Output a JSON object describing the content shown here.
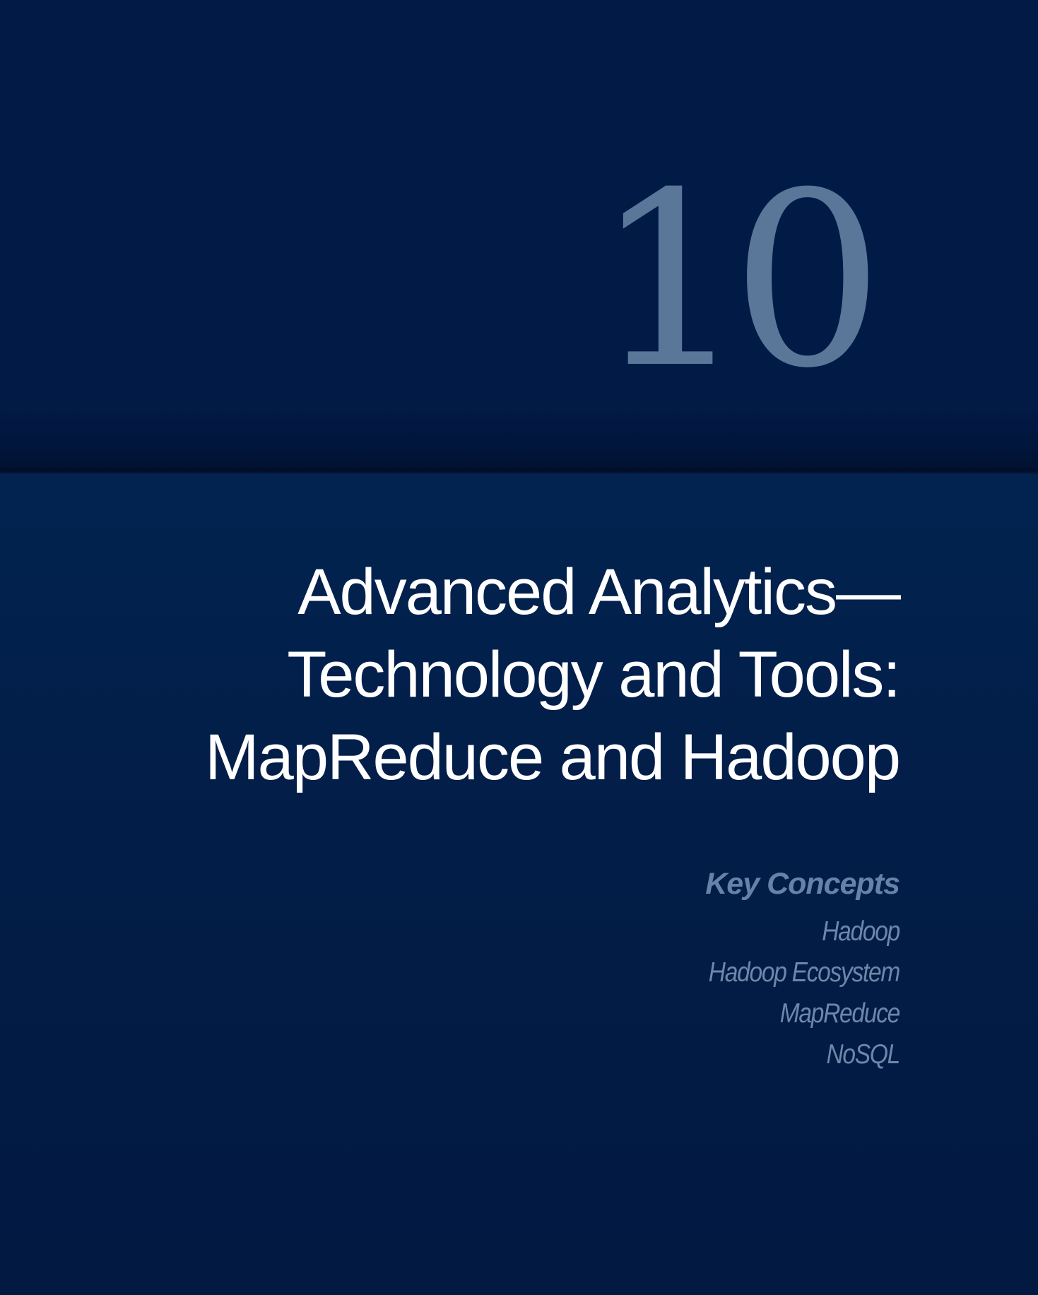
{
  "chapter": {
    "number": "10",
    "title_lines": [
      "Advanced Analytics—",
      "Technology and Tools:",
      "MapReduce and Hadoop"
    ]
  },
  "key_concepts": {
    "heading": "Key Concepts",
    "items": [
      "Hadoop",
      "Hadoop Ecosystem",
      "MapReduce",
      "NoSQL"
    ]
  },
  "colors": {
    "background_top": "#021a46",
    "background_bottom": "#022350",
    "chapter_number": "#5a7698",
    "title": "#ffffff",
    "key_concepts": "#6682a8"
  }
}
